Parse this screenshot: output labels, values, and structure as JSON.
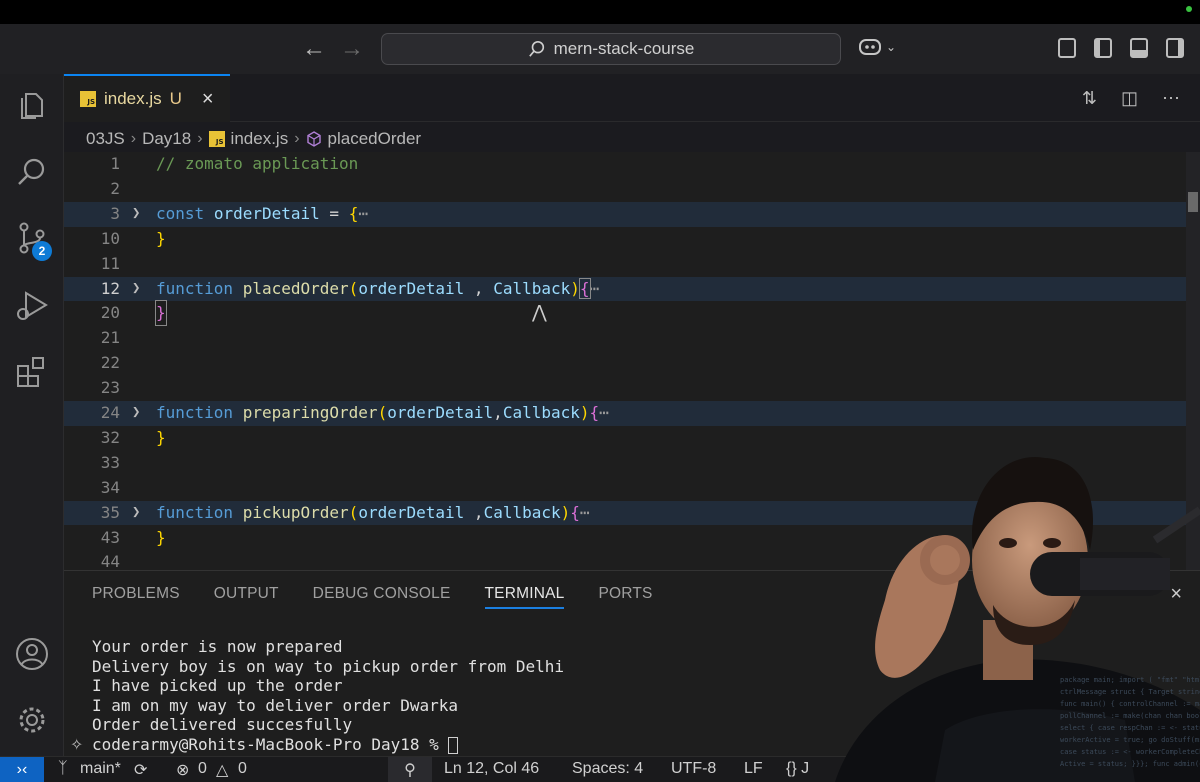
{
  "titlebar": {
    "search_text": "mern-stack-course",
    "back_icon": "arrow-left-icon",
    "forward_icon": "arrow-right-icon"
  },
  "activitybar": {
    "items": [
      {
        "name": "explorer",
        "icon": "files-icon"
      },
      {
        "name": "search",
        "icon": "search-icon"
      },
      {
        "name": "source-control",
        "icon": "source-control-icon",
        "badge": "2"
      },
      {
        "name": "run-debug",
        "icon": "run-debug-icon"
      },
      {
        "name": "extensions",
        "icon": "extensions-icon"
      },
      {
        "name": "accounts",
        "icon": "account-icon"
      },
      {
        "name": "settings",
        "icon": "gear-icon"
      }
    ]
  },
  "tab": {
    "label": "index.js",
    "status": "U",
    "close": "×",
    "badge": "JS"
  },
  "breadcrumb": {
    "folder1": "03JS",
    "folder2": "Day18",
    "file": "index.js",
    "symbol": "placedOrder"
  },
  "editor": {
    "lines": [
      {
        "n": "1"
      },
      {
        "n": "2"
      },
      {
        "n": "3"
      },
      {
        "n": "10"
      },
      {
        "n": "11"
      },
      {
        "n": "12"
      },
      {
        "n": "20"
      },
      {
        "n": "21"
      },
      {
        "n": "22"
      },
      {
        "n": "23"
      },
      {
        "n": "24"
      },
      {
        "n": "32"
      },
      {
        "n": "33"
      },
      {
        "n": "34"
      },
      {
        "n": "35"
      },
      {
        "n": "43"
      },
      {
        "n": "44"
      }
    ],
    "comment": "// zomato application",
    "kw_const": "const",
    "kw_function": "function",
    "order_detail_var": "orderDetail",
    "fn_placed": "placedOrder",
    "fn_preparing": "preparingOrder",
    "fn_pickup": "pickupOrder",
    "param_order": "orderDetail",
    "param_callback": "Callback",
    "ellipsis": "⋯"
  },
  "panel": {
    "tabs": [
      "PROBLEMS",
      "OUTPUT",
      "DEBUG CONSOLE",
      "TERMINAL",
      "PORTS"
    ],
    "active_tab": "TERMINAL",
    "terminal_lines": [
      "Your order is now prepared",
      "Delivery boy is on way to pickup order from Delhi",
      "I have picked up the order",
      "I am on my way to deliver order Dwarka",
      "Order delivered succesfully"
    ],
    "prompt": "coderarmy@Rohits-MacBook-Pro Day18 % "
  },
  "statusbar": {
    "branch": "main*",
    "errors": "0",
    "warnings": "0",
    "position": "Ln 12, Col 46",
    "spaces": "Spaces: 4",
    "encoding": "UTF-8",
    "eol": "LF",
    "language": "{} J"
  }
}
